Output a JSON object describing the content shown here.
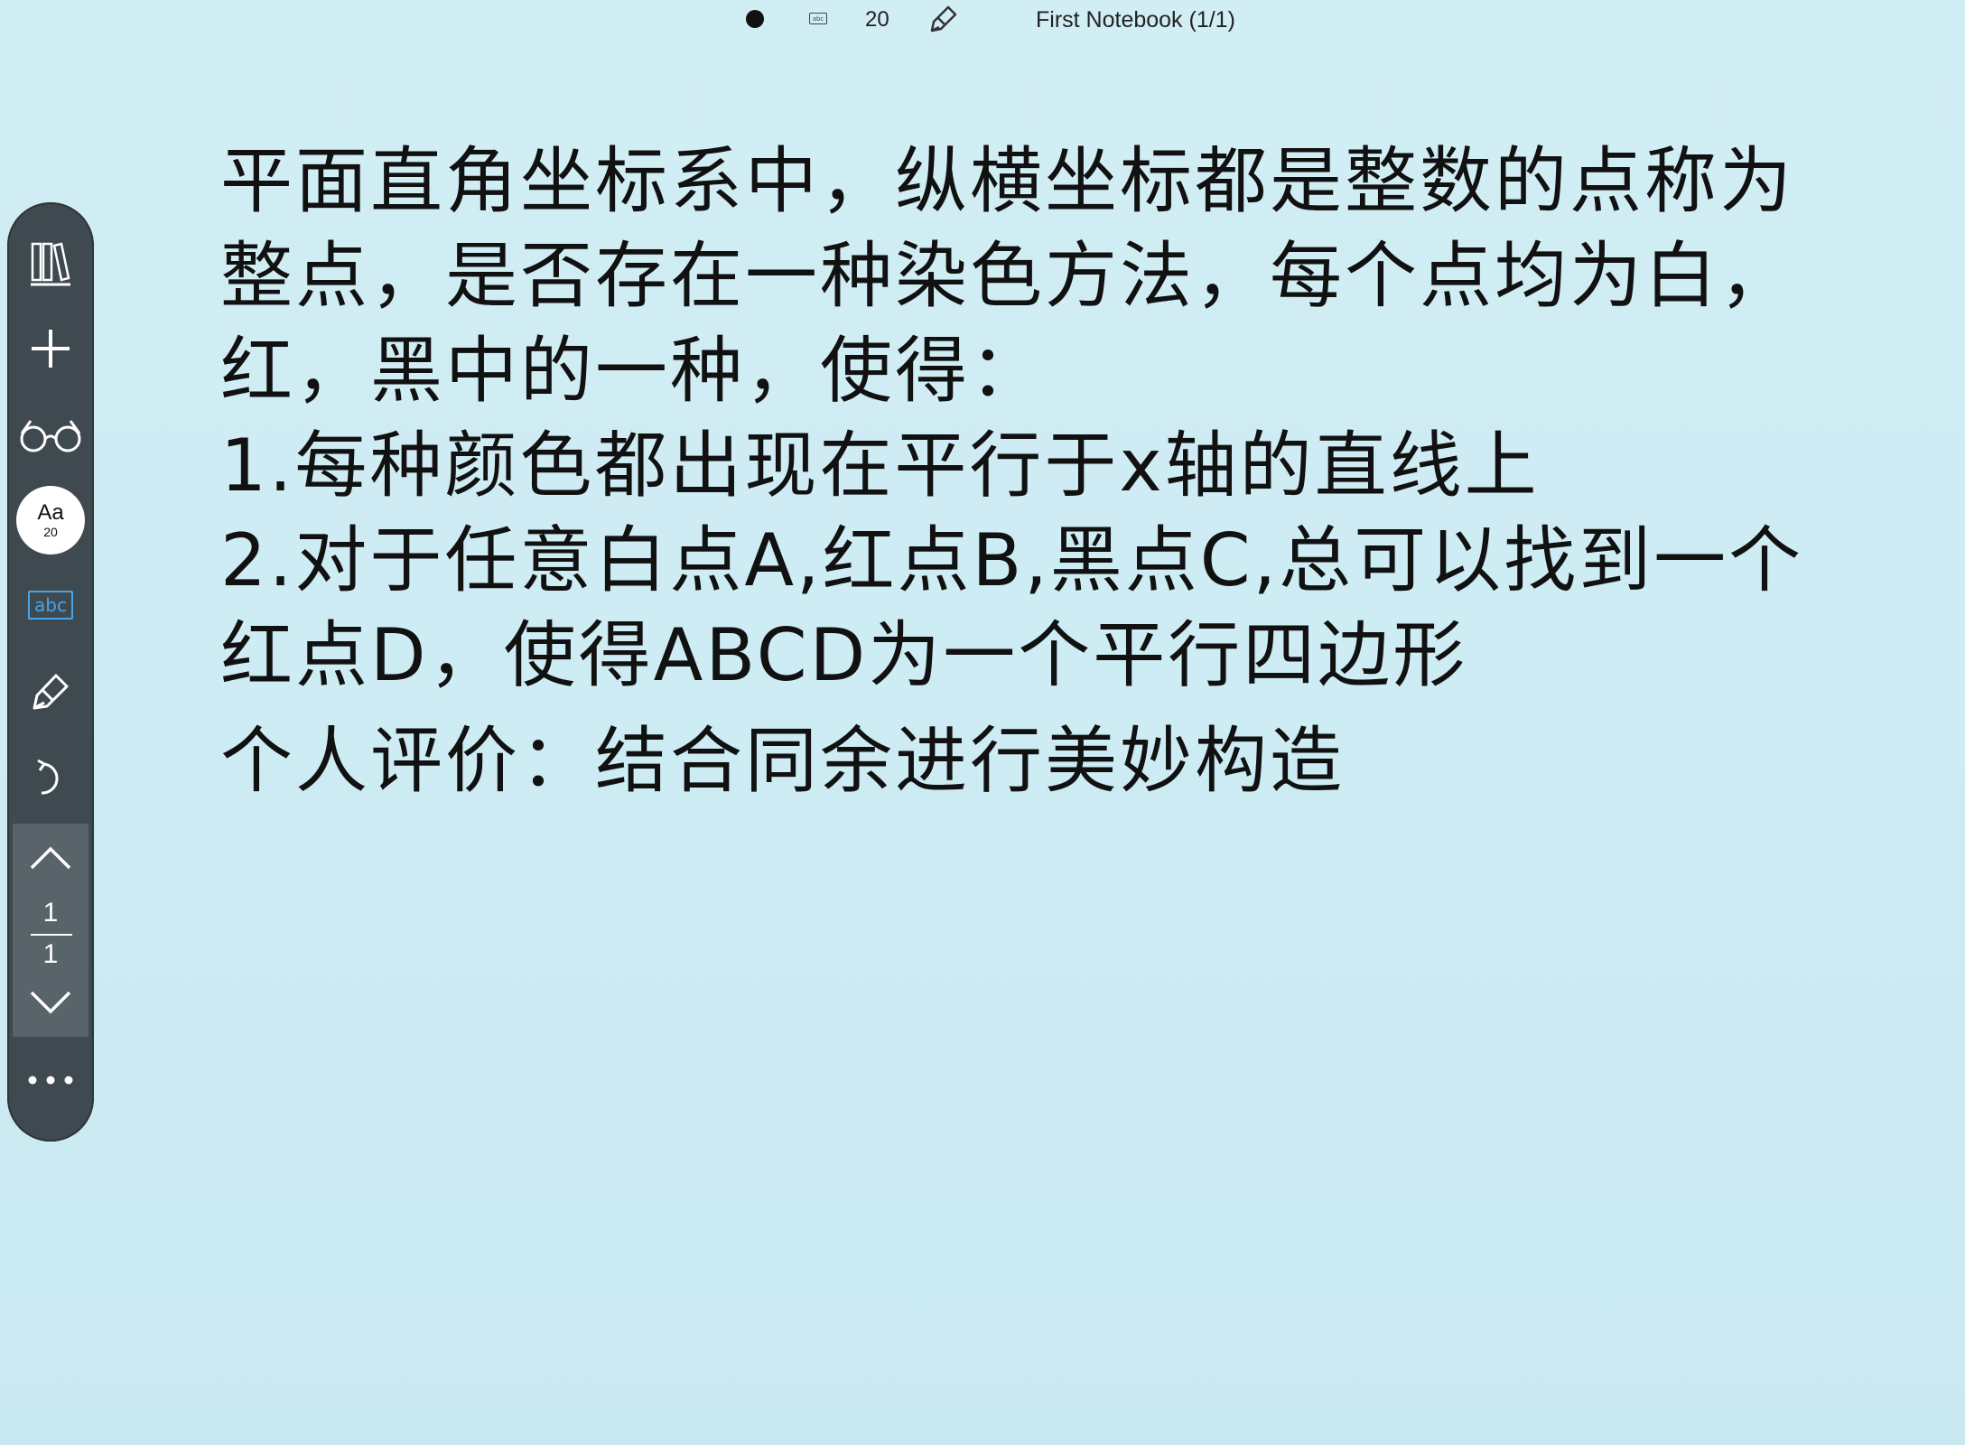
{
  "top_bar": {
    "font_size": "20",
    "abc_label": "abc",
    "notebook_title": "First Notebook (1/1)"
  },
  "sidebar": {
    "icons": [
      "library-icon",
      "plus-icon",
      "glasses-icon",
      "font-size",
      "abc-text-icon",
      "pen-icon",
      "undo-icon",
      "chevron-up-icon",
      "chevron-down-icon",
      "more-icon"
    ],
    "font_label": "Aa",
    "font_size": "20",
    "abc_label": "abc",
    "page_current": "1",
    "page_total": "1",
    "accent_color": "#4aa3e6",
    "toolbar_color": "#3f4a50"
  },
  "content": {
    "lines": [
      "平面直角坐标系中，纵横坐标都是整数的点称为",
      "整点，是否存在一种染色方法，每个点均为白，",
      "红，黑中的一种，使得：",
      "1.每种颜色都出现在平行于x轴的直线上",
      "2.对于任意白点A,红点B,黑点C,总可以找到一个",
      "红点D，使得ABCD为一个平行四边形"
    ],
    "comment": "个人评价：结合同余进行美妙构造"
  },
  "background_color": "#cdecf3"
}
